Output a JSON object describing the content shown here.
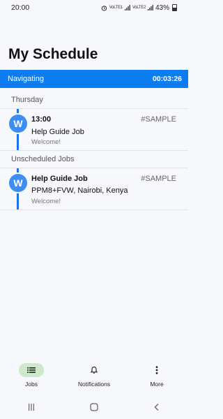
{
  "status_bar": {
    "time": "20:00",
    "signal_1": "VoLTE1",
    "signal_2": "VoLTE2",
    "battery": "43%"
  },
  "page": {
    "title": "My Schedule"
  },
  "navigating": {
    "label": "Navigating",
    "timer": "00:03:26"
  },
  "sections": [
    {
      "header": "Thursday",
      "jobs": [
        {
          "avatar": "W",
          "time": "13:00",
          "tag": "#SAMPLE",
          "title": "Help Guide Job",
          "message": "Welcome!"
        }
      ]
    },
    {
      "header": "Unscheduled Jobs",
      "jobs": [
        {
          "avatar": "W",
          "title": "Help Guide Job",
          "tag": "#SAMPLE",
          "location": "PPM8+FVW, Nairobi, Kenya",
          "message": "Welcome!"
        }
      ]
    }
  ],
  "bottom_nav": {
    "items": [
      {
        "label": "Jobs",
        "icon": "list-icon",
        "active": true
      },
      {
        "label": "Notifications",
        "icon": "bell-icon",
        "active": false
      },
      {
        "label": "More",
        "icon": "more-vertical-icon",
        "active": false
      }
    ]
  },
  "system_nav": {
    "icons": [
      "recents-icon",
      "home-icon",
      "back-icon"
    ]
  },
  "colors": {
    "accent": "#0c7cf0",
    "avatar": "#3d8ef2",
    "timeline": "#1a73e8",
    "active_pill": "#cde9c9",
    "background": "#f7f8fc"
  }
}
